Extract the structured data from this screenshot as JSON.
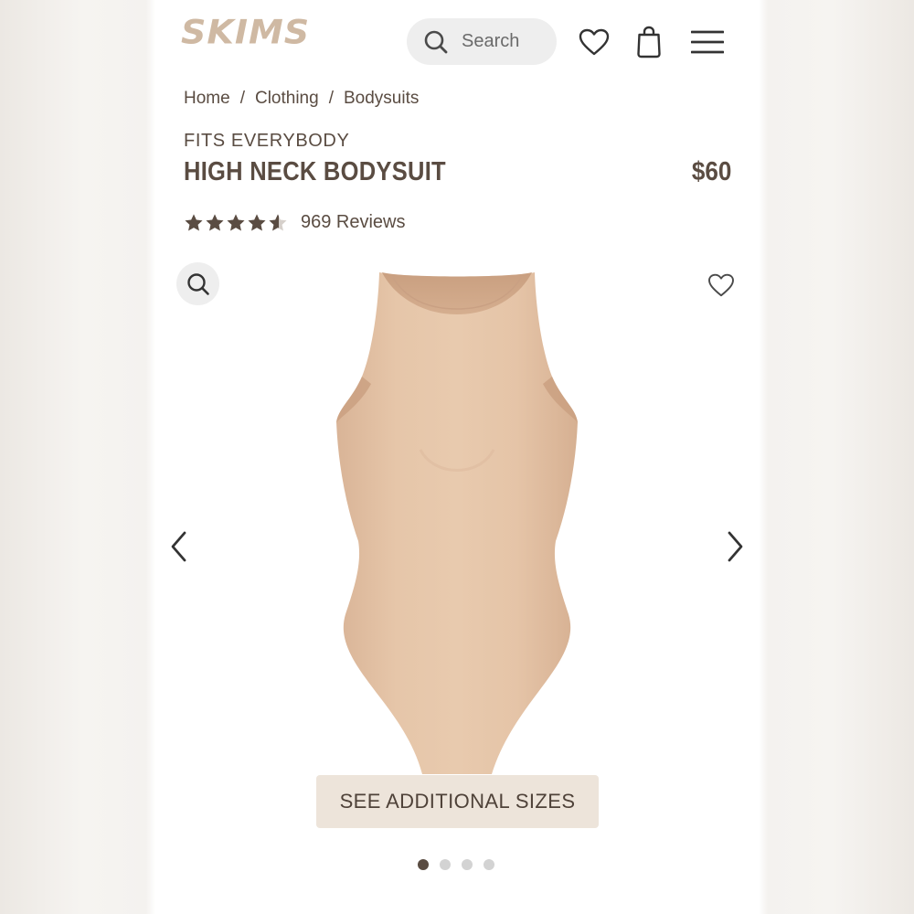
{
  "brand": {
    "logo_text": "SKIMS",
    "logo_color": "#cfb9a3"
  },
  "header": {
    "search_placeholder": "Search",
    "icons": [
      "search-icon",
      "heart-icon",
      "shopping-bag-icon",
      "hamburger-menu-icon"
    ]
  },
  "breadcrumb": {
    "items": [
      "Home",
      "Clothing",
      "Bodysuits"
    ],
    "separator": "/"
  },
  "product": {
    "collection": "FITS EVERYBODY",
    "title": "HIGH NECK BODYSUIT",
    "price": "$60",
    "rating_value": 4.5,
    "rating_max": 5,
    "reviews_label": "969 Reviews",
    "image_color": "#e3c3a6"
  },
  "gallery": {
    "sizes_button_label": "SEE ADDITIONAL SIZES",
    "slide_count": 4,
    "active_slide": 1,
    "icons": [
      "zoom-icon",
      "favorite-heart-icon",
      "chevron-left-icon",
      "chevron-right-icon"
    ]
  },
  "colors": {
    "text": "#5a4c42",
    "pill_background": "#eeeeee",
    "sizes_button_background": "#ede4da"
  }
}
